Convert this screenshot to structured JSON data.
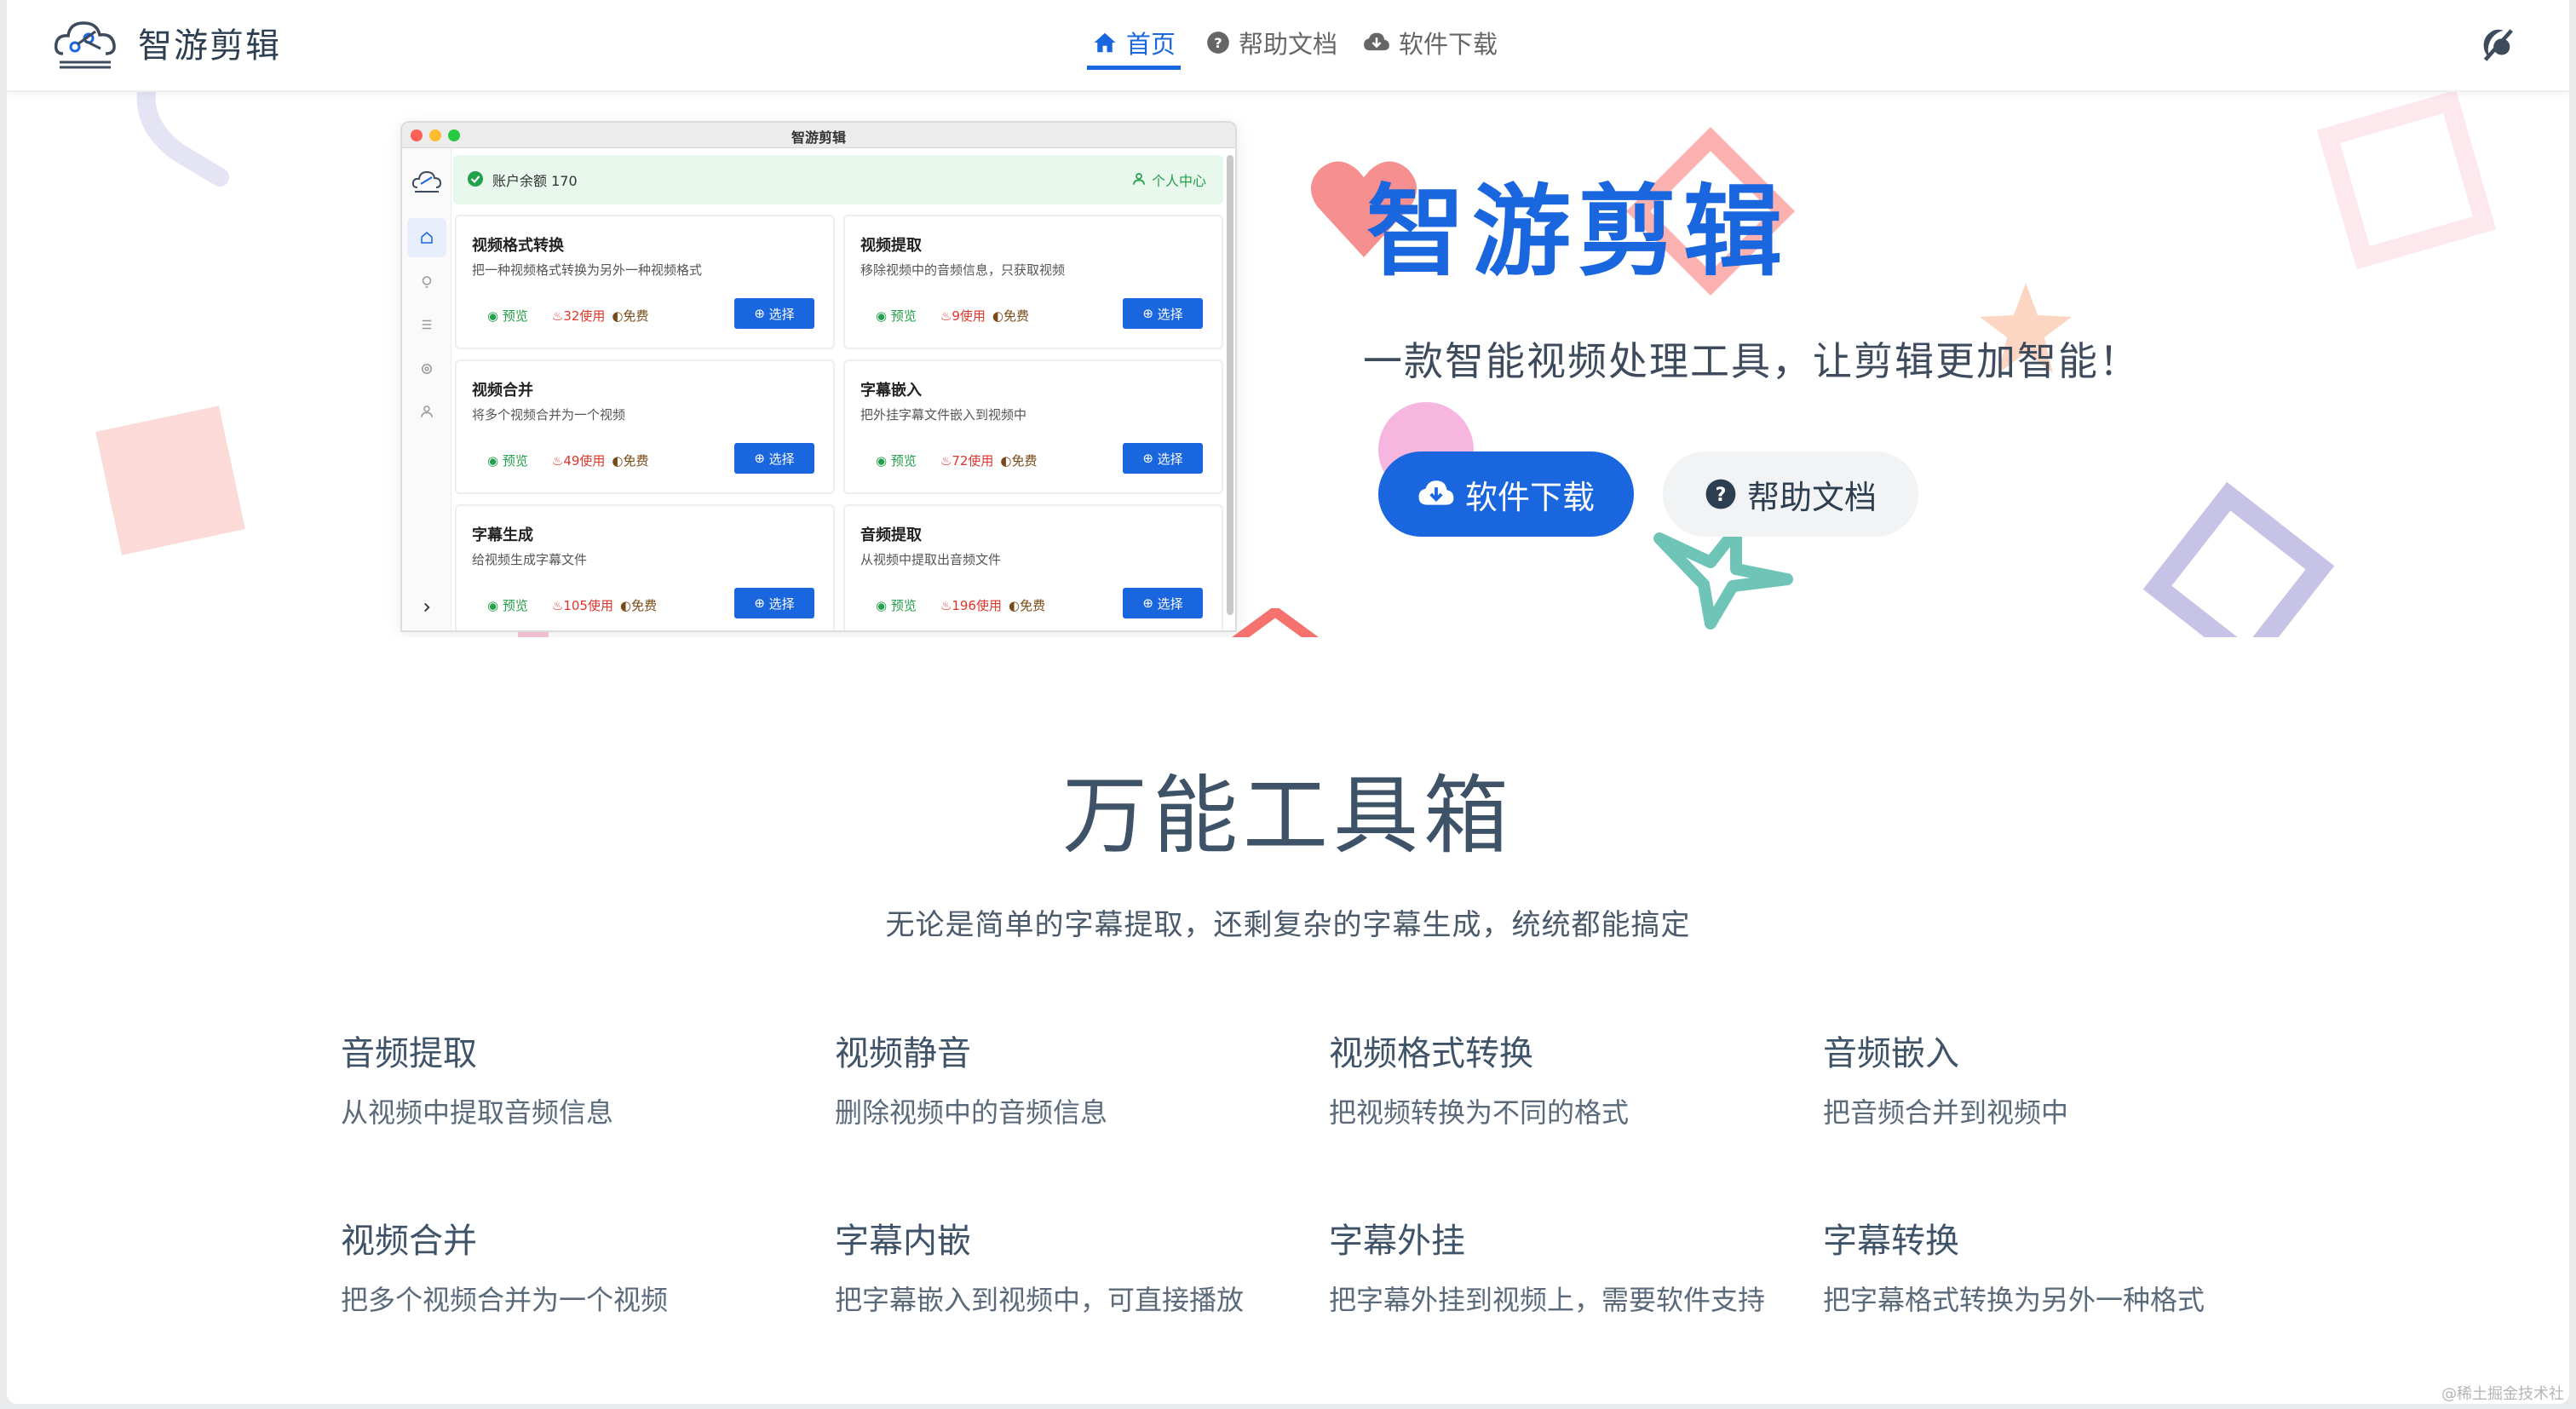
{
  "nav": {
    "brand": "智游剪辑",
    "items": [
      {
        "label": "首页",
        "icon": "home-icon",
        "active": true
      },
      {
        "label": "帮助文档",
        "icon": "help-circle-icon",
        "active": false
      },
      {
        "label": "软件下载",
        "icon": "cloud-download-icon",
        "active": false
      }
    ],
    "theme_icon": "theme-toggle-icon"
  },
  "app_preview": {
    "title": "智游剪辑",
    "balance": "账户余额 170",
    "user_center": "个人中心",
    "cards": [
      {
        "title": "视频格式转换",
        "desc": "把一种视频格式转换为另外一种视频格式",
        "preview": "预览",
        "uses": "32使用",
        "free": "免费",
        "button": "选择"
      },
      {
        "title": "视频提取",
        "desc": "移除视频中的音频信息，只获取视频",
        "preview": "预览",
        "uses": "9使用",
        "free": "免费",
        "button": "选择"
      },
      {
        "title": "视频合并",
        "desc": "将多个视频合并为一个视频",
        "preview": "预览",
        "uses": "49使用",
        "free": "免费",
        "button": "选择"
      },
      {
        "title": "字幕嵌入",
        "desc": "把外挂字幕文件嵌入到视频中",
        "preview": "预览",
        "uses": "72使用",
        "free": "免费",
        "button": "选择"
      },
      {
        "title": "字幕生成",
        "desc": "给视频生成字幕文件",
        "preview": "预览",
        "uses": "105使用",
        "free": "免费",
        "button": "选择"
      },
      {
        "title": "音频提取",
        "desc": "从视频中提取出音频文件",
        "preview": "预览",
        "uses": "196使用",
        "free": "免费",
        "button": "选择"
      }
    ]
  },
  "hero": {
    "title": "智游剪辑",
    "subtitle": "一款智能视频处理工具，让剪辑更加智能！",
    "primary_button": "软件下载",
    "secondary_button": "帮助文档"
  },
  "features": {
    "title": "万能工具箱",
    "subtitle": "无论是简单的字幕提取，还剩复杂的字幕生成，统统都能搞定",
    "items": [
      {
        "title": "音频提取",
        "desc": "从视频中提取音频信息"
      },
      {
        "title": "视频静音",
        "desc": "删除视频中的音频信息"
      },
      {
        "title": "视频格式转换",
        "desc": "把视频转换为不同的格式"
      },
      {
        "title": "音频嵌入",
        "desc": "把音频合并到视频中"
      },
      {
        "title": "视频合并",
        "desc": "把多个视频合并为一个视频"
      },
      {
        "title": "字幕内嵌",
        "desc": "把字幕嵌入到视频中，可直接播放"
      },
      {
        "title": "字幕外挂",
        "desc": "把字幕外挂到视频上，需要软件支持"
      },
      {
        "title": "字幕转换",
        "desc": "把字幕格式转换为另外一种格式"
      }
    ]
  },
  "watermark": "@稀土掘金技术社区",
  "colors": {
    "accent": "#1a66de",
    "heading": "#3f5368",
    "success": "#23a04a",
    "danger": "#e0352b"
  }
}
